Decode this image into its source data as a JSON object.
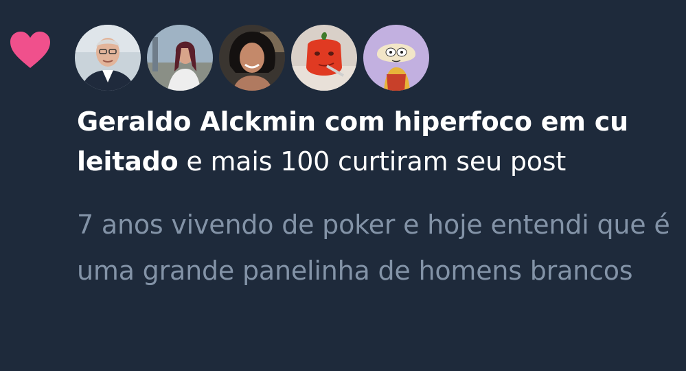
{
  "notification": {
    "type_icon": "heart-icon",
    "icon_color": "#f0508c",
    "actor_name": "Geraldo Alckmin com hiperfoco em cu leitado",
    "action_text": " e mais 100 curtiram seu post",
    "post_excerpt": "7 anos vivendo de poker e hoje entendi que é uma grande panelinha de homens brancos",
    "avatars": [
      {
        "label": "avatar-1"
      },
      {
        "label": "avatar-2"
      },
      {
        "label": "avatar-3"
      },
      {
        "label": "avatar-4"
      },
      {
        "label": "avatar-5"
      }
    ]
  },
  "colors": {
    "background": "#1e2a3b",
    "text_primary": "#ffffff",
    "text_secondary": "#8393a7"
  }
}
